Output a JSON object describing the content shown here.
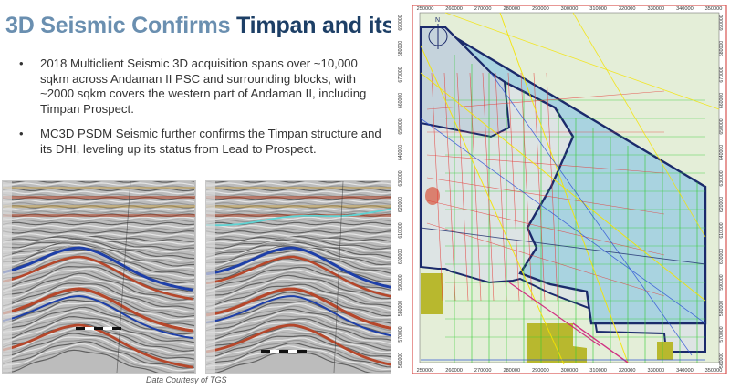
{
  "slide": {
    "title_part1": "3D Seismic Confirms",
    "title_part2": "Timpan and its DHI",
    "bullets": [
      "2018 Multiclient Seismic 3D acquisition spans over ~10,000 sqkm across Andaman II PSC and surrounding blocks, with ~2000 sqkm covers the western part of Andaman II, including Timpan Prospect.",
      "MC3D PSDM Seismic further confirms the Timpan structure and its DHI, leveling up its status from Lead to Prospect."
    ],
    "caption": "Data Courtesy of TGS",
    "bullet_symbol": "•"
  },
  "map": {
    "x_ticks": [
      "250000",
      "260000",
      "270000",
      "280000",
      "290000",
      "300000",
      "310000",
      "320000",
      "330000",
      "340000",
      "350000"
    ],
    "y_ticks": [
      "690000",
      "680000",
      "670000",
      "660000",
      "650000",
      "640000",
      "630000",
      "620000",
      "610000",
      "600000",
      "590000",
      "580000",
      "570000",
      "560000"
    ],
    "colors": {
      "block_fill": "#a9d3e0",
      "block_outline": "#1b2a6b",
      "background": "#e4eed8",
      "frame": "#d9534f",
      "green_lines": "#33cc33",
      "red_lines": "#e53935",
      "yellow_lines": "#f5e400"
    },
    "north_arrow": "N"
  },
  "seismic": {
    "colors": {
      "peak": "#1e3fa8",
      "trough": "#b5472b",
      "amber": "#c8a85a",
      "background": "#bcbcbc"
    }
  }
}
